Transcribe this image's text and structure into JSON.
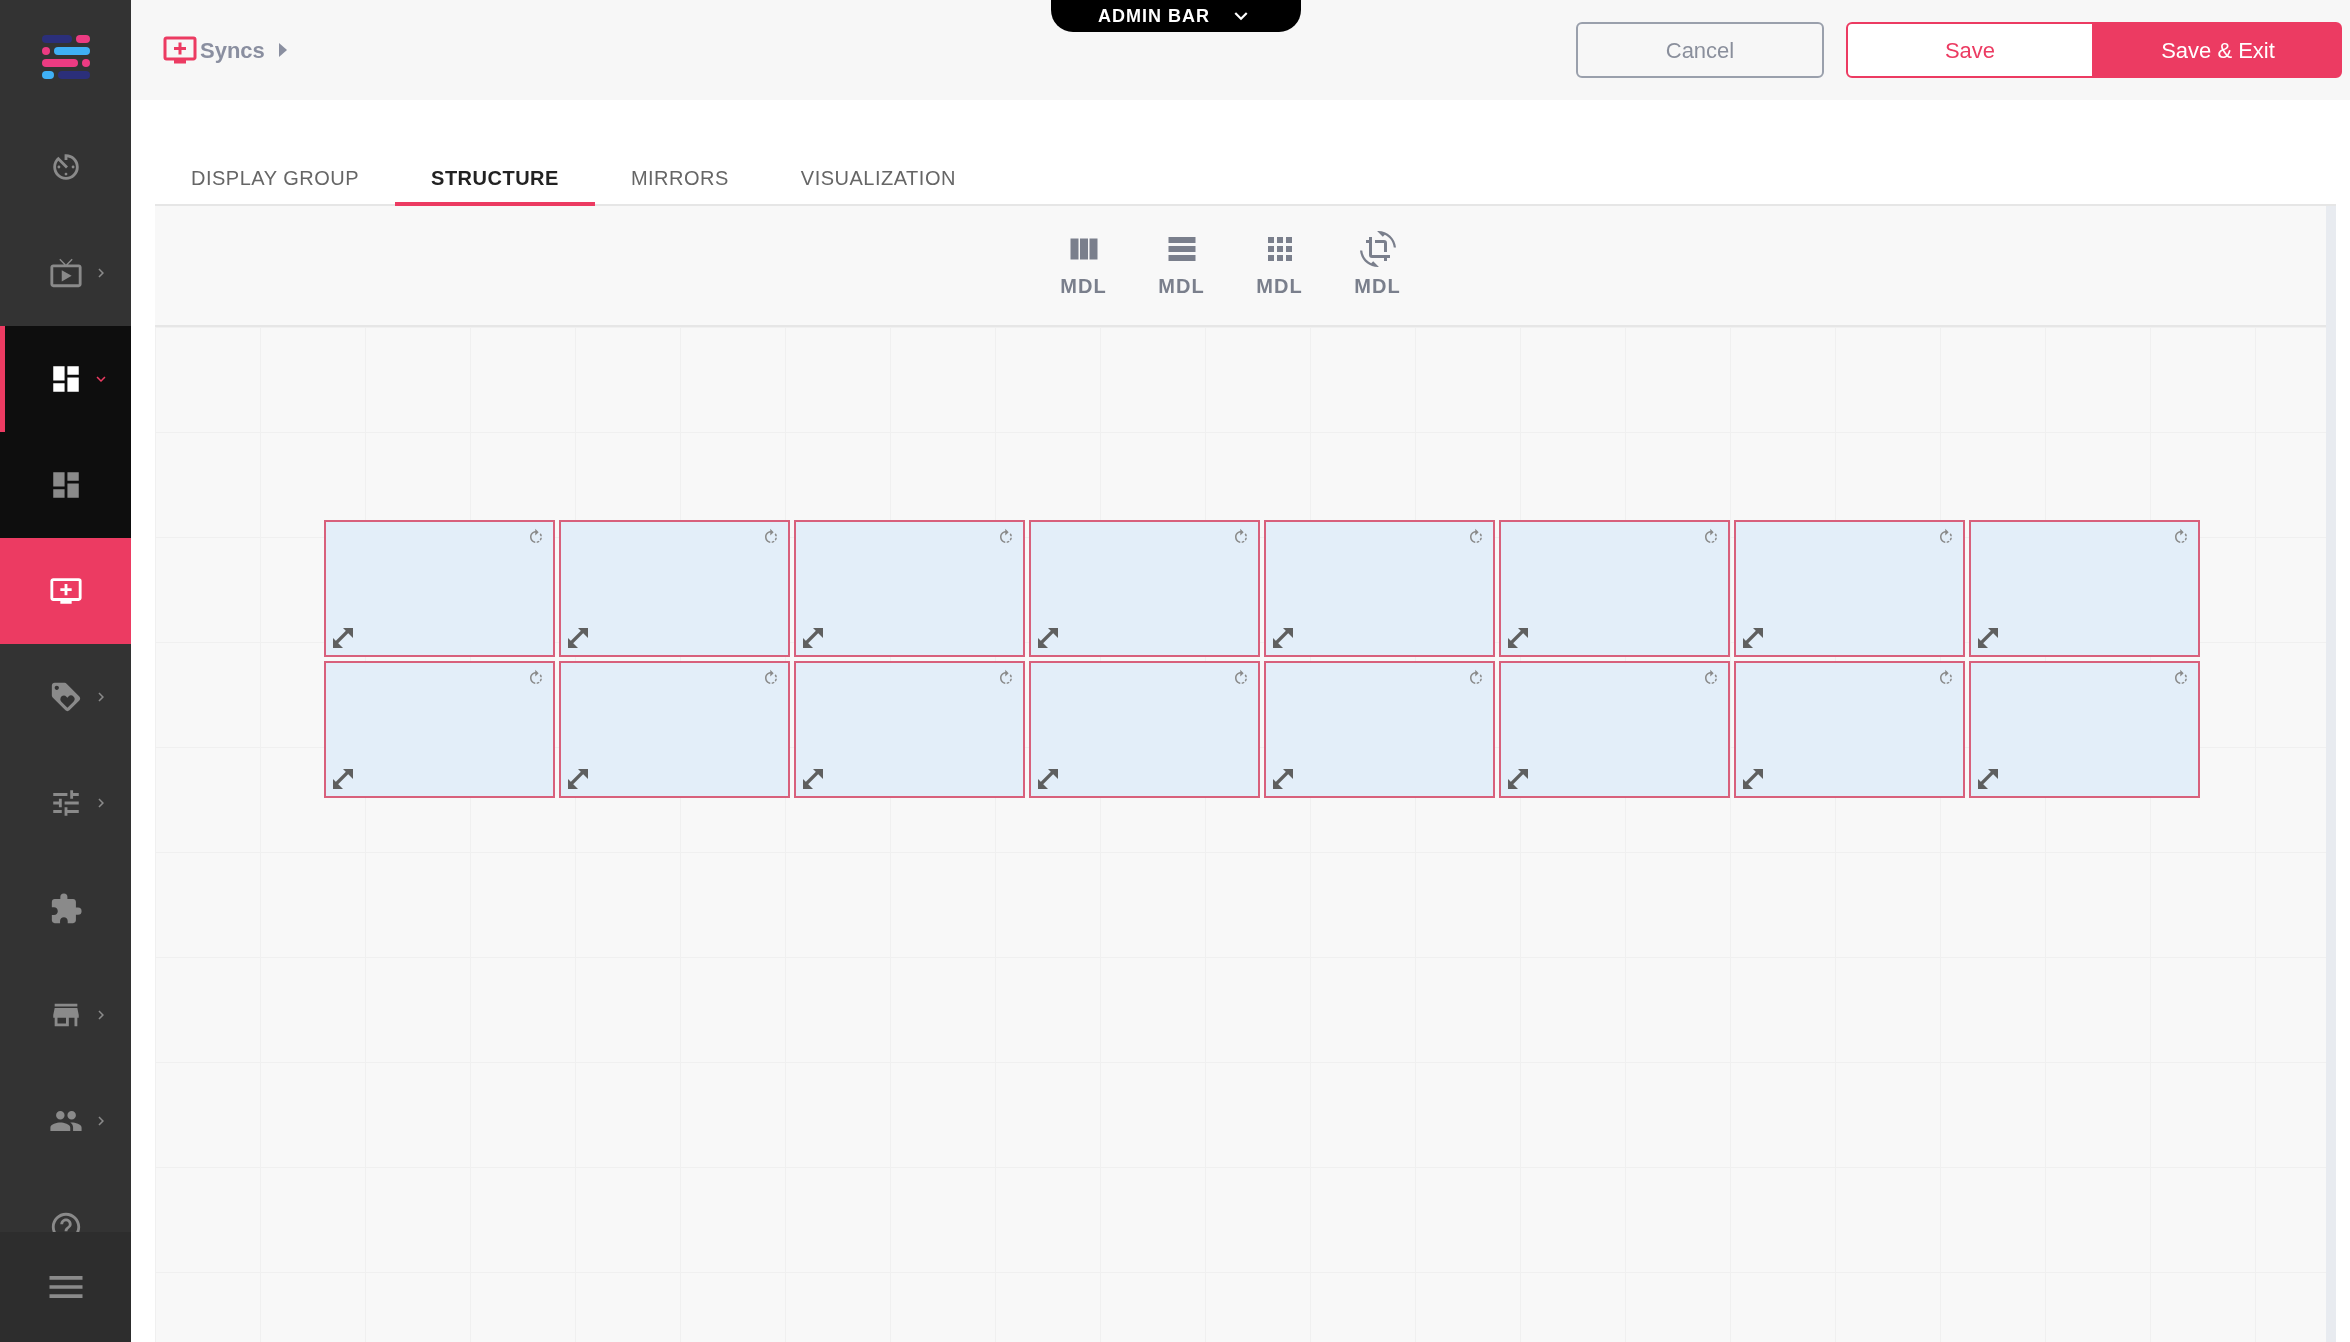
{
  "sidebar": {
    "items": [
      {
        "selected": false
      },
      {
        "selected": false,
        "expanded": false
      },
      {
        "selected": false,
        "expanded": true,
        "children": [
          {
            "selected": false
          },
          {
            "selected": true
          }
        ]
      },
      {
        "selected": false,
        "expanded": false
      },
      {
        "selected": false,
        "expanded": false
      },
      {
        "selected": false
      },
      {
        "selected": false,
        "expanded": false
      },
      {
        "selected": false,
        "expanded": false
      },
      {
        "selected": false
      }
    ]
  },
  "breadcrumb": {
    "label": "Syncs"
  },
  "admin_bar": {
    "label": "ADMIN BAR"
  },
  "buttons": [
    {
      "label": "Cancel",
      "kind": "outline"
    },
    {
      "label": "Save",
      "kind": "accent-outline"
    },
    {
      "label": "Save & Exit",
      "kind": "primary"
    }
  ],
  "tabs": [
    {
      "label": "DISPLAY GROUP",
      "selected": false
    },
    {
      "label": "STRUCTURE",
      "selected": true
    },
    {
      "label": "MIRRORS",
      "selected": false
    },
    {
      "label": "VISUALIZATION",
      "selected": false
    }
  ],
  "tools": [
    {
      "label": "MDL"
    },
    {
      "label": "MDL"
    },
    {
      "label": "MDL"
    },
    {
      "label": "MDL"
    }
  ]
}
